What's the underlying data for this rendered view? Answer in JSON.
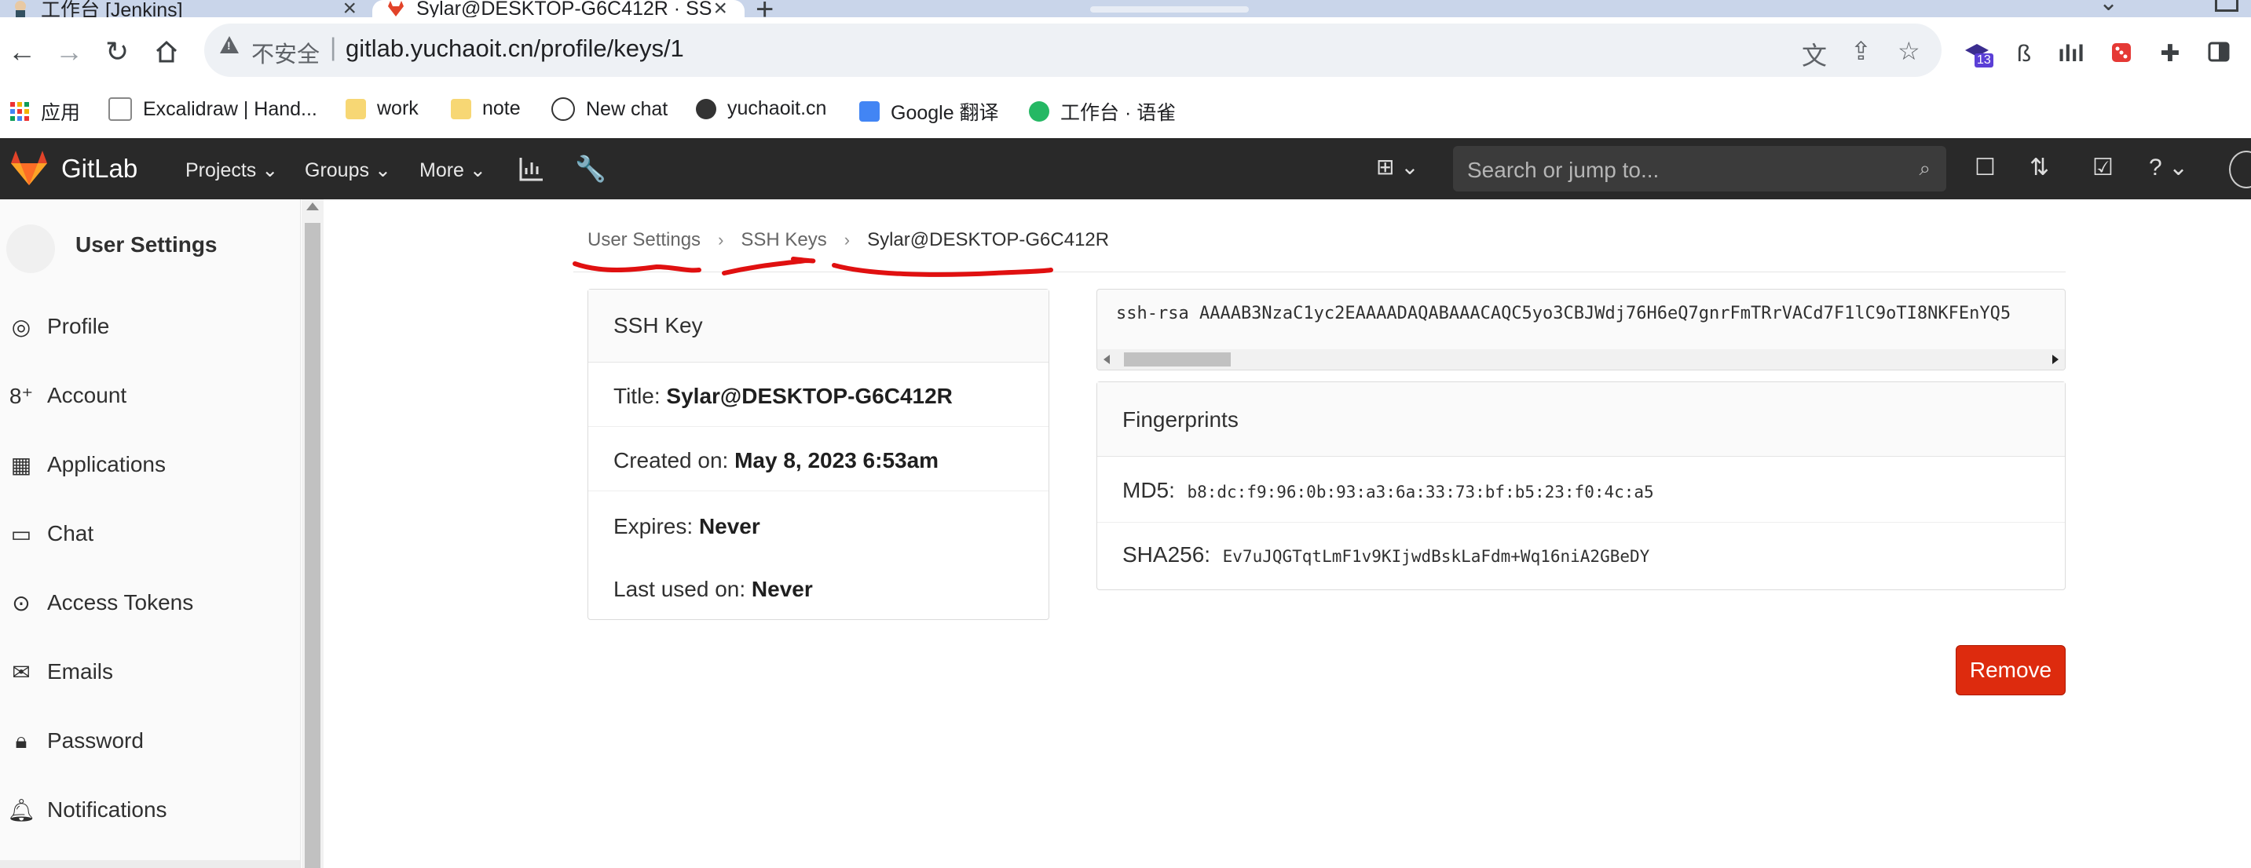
{
  "browser": {
    "tabs": [
      {
        "title": "工作台 [Jenkins]",
        "active": false
      },
      {
        "title": "Sylar@DESKTOP-G6C412R · SS",
        "active": true
      }
    ],
    "new_tab": "+",
    "security_label": "不安全",
    "url": "gitlab.yuchaoit.cn/profile/keys/1",
    "extension_badge": "13",
    "bookmarks": [
      {
        "label": "应用",
        "icon": "apps-grid-icon"
      },
      {
        "label": "Excalidraw | Hand...",
        "icon": "page-icon"
      },
      {
        "label": "work",
        "icon": "folder-icon"
      },
      {
        "label": "note",
        "icon": "folder-icon"
      },
      {
        "label": "New chat",
        "icon": "openai-icon"
      },
      {
        "label": "yuchaoit.cn",
        "icon": "globe-icon"
      },
      {
        "label": "Google 翻译",
        "icon": "translate-icon"
      },
      {
        "label": "工作台 · 语雀",
        "icon": "yuque-icon"
      }
    ]
  },
  "gitlab_nav": {
    "brand": "GitLab",
    "menus": [
      "Projects",
      "Groups",
      "More"
    ],
    "search_placeholder": "Search or jump to..."
  },
  "sidebar": {
    "title": "User Settings",
    "items": [
      {
        "label": "Profile",
        "icon": "profile-icon"
      },
      {
        "label": "Account",
        "icon": "account-icon"
      },
      {
        "label": "Applications",
        "icon": "applications-icon"
      },
      {
        "label": "Chat",
        "icon": "chat-icon"
      },
      {
        "label": "Access Tokens",
        "icon": "token-icon"
      },
      {
        "label": "Emails",
        "icon": "email-icon"
      },
      {
        "label": "Password",
        "icon": "lock-icon"
      },
      {
        "label": "Notifications",
        "icon": "bell-icon"
      }
    ]
  },
  "breadcrumb": {
    "items": [
      "User Settings",
      "SSH Keys",
      "Sylar@DESKTOP-G6C412R"
    ],
    "separator": "›"
  },
  "ssh_key_card": {
    "header": "SSH Key",
    "title_label": "Title:",
    "title_value": "Sylar@DESKTOP-G6C412R",
    "created_label": "Created on:",
    "created_value": "May 8, 2023 6:53am",
    "expires_label": "Expires:",
    "expires_value": "Never",
    "last_used_label": "Last used on:",
    "last_used_value": "Never"
  },
  "key_box": {
    "content": "ssh-rsa AAAAB3NzaC1yc2EAAAADAQABAAACAQC5yo3CBJWdj76H6eQ7gnrFmTRrVACd7F1lC9oTI8NKFEnYQ5"
  },
  "fingerprints": {
    "header": "Fingerprints",
    "md5_label": "MD5:",
    "md5_value": "b8:dc:f9:96:0b:93:a3:6a:33:73:bf:b5:23:f0:4c:a5",
    "sha_label": "SHA256:",
    "sha_value": "Ev7uJQGTqtLmF1v9KIjwdBskLaFdm+Wq16niA2GBeDY"
  },
  "actions": {
    "remove_label": "Remove"
  },
  "colors": {
    "gitlab_nav": "#292929",
    "remove_button": "#dd2b0e",
    "annotation": "#e01010"
  }
}
